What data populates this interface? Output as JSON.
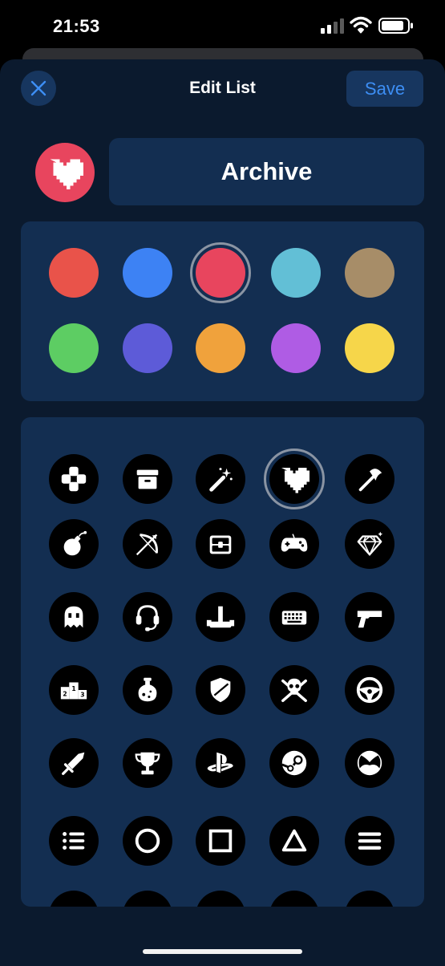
{
  "status_bar": {
    "time": "21:53"
  },
  "header": {
    "title": "Edit List",
    "save_label": "Save"
  },
  "list": {
    "name": "Archive",
    "selected_icon": "heart-icon",
    "selected_color": "#e8455e"
  },
  "colors": [
    {
      "name": "red",
      "hex": "#e9534a"
    },
    {
      "name": "blue",
      "hex": "#3d82f4"
    },
    {
      "name": "pink-red",
      "hex": "#e8455e",
      "selected": true
    },
    {
      "name": "teal",
      "hex": "#62bfd6"
    },
    {
      "name": "tan",
      "hex": "#a78d68"
    },
    {
      "name": "green",
      "hex": "#5dcd63"
    },
    {
      "name": "indigo",
      "hex": "#5d5bd8"
    },
    {
      "name": "orange",
      "hex": "#f0a23c"
    },
    {
      "name": "purple",
      "hex": "#af5ce4"
    },
    {
      "name": "yellow",
      "hex": "#f6d64a"
    }
  ],
  "icons": [
    "gamepad-dpad-icon",
    "archive-box-icon",
    "magic-wand-icon",
    "heart-icon",
    "axe-icon",
    "bomb-icon",
    "bow-arrow-icon",
    "treasure-chest-icon",
    "game-controller-icon",
    "diamond-icon",
    "ghost-icon",
    "headset-icon",
    "joystick-icon",
    "keyboard-icon",
    "pistol-icon",
    "podium-icon",
    "potion-icon",
    "shield-icon",
    "skull-crossbones-icon",
    "steering-wheel-icon",
    "sword-icon",
    "trophy-icon",
    "playstation-logo-icon",
    "steam-logo-icon",
    "xbox-logo-icon",
    "list-icon",
    "circle-icon",
    "square-icon",
    "triangle-icon",
    "menu-lines-icon"
  ]
}
